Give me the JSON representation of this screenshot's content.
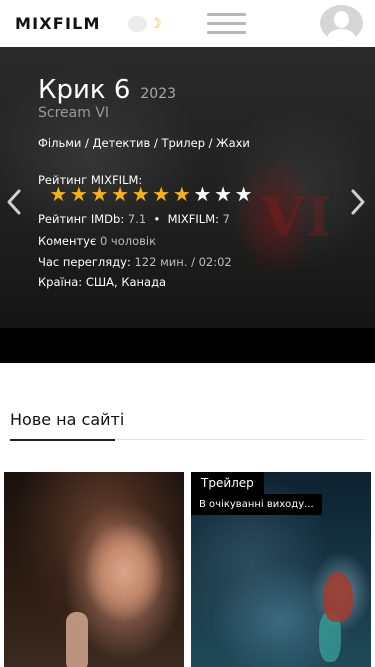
{
  "header": {
    "logo": "MIXFILM",
    "theme_icon": "moon-icon",
    "menu_icon": "hamburger-icon",
    "avatar_icon": "user-avatar-icon"
  },
  "hero": {
    "title": "Крик 6",
    "year": "2023",
    "original_title": "Scream VI",
    "genres": "Фільми / Детектив / Трилер / Жахи",
    "rating_label": "Рейтинг MIXFILM:",
    "rating_stars": 7,
    "rating_max": 10,
    "imdb_label": "Рейтинг IMDb:",
    "imdb_value": "7.1",
    "separator": "•",
    "mixfilm_label": "MIXFILM:",
    "mixfilm_value": "7",
    "comments_label": "Коментує",
    "comments_value": "0 чоловік",
    "runtime_label": "Час перегляду:",
    "runtime_value": "122 мин. / 02:02",
    "country_label": "Країна:",
    "country_value": "США, Канада",
    "prev_icon": "chevron-left-icon",
    "next_icon": "chevron-right-icon",
    "colors": {
      "star_on": "#f5b214",
      "star_off": "#ffffff"
    }
  },
  "new_section": {
    "title": "Нове на сайті"
  },
  "cards": [
    {
      "badge": "",
      "subbadge": ""
    },
    {
      "badge": "Трейлер",
      "subbadge": "В очікуванні виходу..."
    }
  ]
}
